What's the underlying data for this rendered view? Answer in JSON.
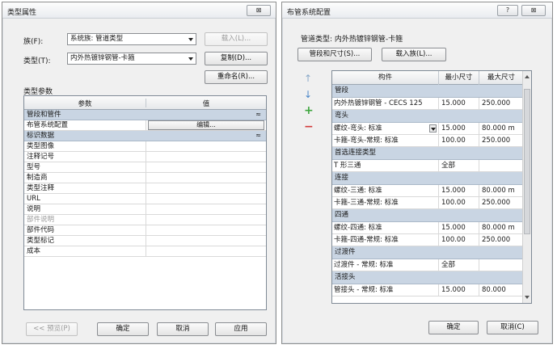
{
  "type_properties": {
    "title": "类型属性",
    "close_label": "⊠",
    "family_label": "族(F):",
    "family_value": "系统族: 管道类型",
    "load_button": "载入(L)...",
    "type_label": "类型(T):",
    "type_value": "内外热镀锌钢管-卡箍",
    "duplicate_button": "复制(D)...",
    "rename_button": "重命名(R)...",
    "section_label": "类型参数",
    "col_param": "参数",
    "col_value": "值",
    "groups": [
      {
        "name": "管段和管件",
        "caret": "≈",
        "rows": [
          {
            "param": "布管系统配置",
            "value": "编辑..."
          }
        ]
      },
      {
        "name": "标识数据",
        "caret": "≈",
        "rows": [
          {
            "param": "类型图像"
          },
          {
            "param": "注释记号"
          },
          {
            "param": "型号"
          },
          {
            "param": "制造商"
          },
          {
            "param": "类型注释"
          },
          {
            "param": "URL"
          },
          {
            "param": "说明"
          },
          {
            "param": "部件说明"
          },
          {
            "param": "部件代码"
          },
          {
            "param": "类型标记"
          },
          {
            "param": "成本"
          }
        ]
      }
    ],
    "preview_button": "<< 预览(P)",
    "ok_button": "确定",
    "cancel_button": "取消",
    "apply_button": "应用"
  },
  "routing_config": {
    "title": "布管系统配置",
    "help_label": "?",
    "close_label": "⊠",
    "pipe_type_label": "管道类型: 内外热镀锌钢管-卡箍",
    "segments_button": "管段和尺寸(S)...",
    "load_family_button": "载入族(L)...",
    "col_component": "构件",
    "col_min": "最小尺寸",
    "col_max": "最大尺寸",
    "sections": [
      {
        "name": "管段",
        "rows": [
          {
            "component": "内外热镀锌钢管 - CECS 125",
            "min": "15.000",
            "max": "250.000"
          }
        ]
      },
      {
        "name": "弯头",
        "rows": [
          {
            "component": "螺纹-弯头: 标准",
            "min": "15.000",
            "max": "80.000 m",
            "dropdown": true
          },
          {
            "component": "卡箍-弯头-常规: 标准",
            "min": "100.00",
            "max": "250.000"
          }
        ]
      },
      {
        "name": "首选连接类型",
        "rows": [
          {
            "component": "T 形三通",
            "min": "全部",
            "max": ""
          }
        ]
      },
      {
        "name": "连接",
        "rows": [
          {
            "component": "螺纹-三通: 标准",
            "min": "15.000",
            "max": "80.000 m"
          },
          {
            "component": "卡箍-三通-常规: 标准",
            "min": "100.00",
            "max": "250.000"
          }
        ]
      },
      {
        "name": "四通",
        "rows": [
          {
            "component": "螺纹-四通: 标准",
            "min": "15.000",
            "max": "80.000 m"
          },
          {
            "component": "卡箍-四通-常规: 标准",
            "min": "100.00",
            "max": "250.000"
          }
        ]
      },
      {
        "name": "过渡件",
        "rows": [
          {
            "component": "过渡件 - 常规: 标准",
            "min": "全部",
            "max": ""
          }
        ]
      },
      {
        "name": "活接头",
        "rows": [
          {
            "component": "管接头 - 常规: 标准",
            "min": "15.000",
            "max": "80.000"
          }
        ]
      }
    ],
    "ok_button": "确定",
    "cancel_button": "取消(C)",
    "icons": [
      "move-up-icon",
      "move-down-icon",
      "add-row-icon",
      "remove-row-icon"
    ],
    "colors": {
      "group_row": "#c9d5e3",
      "add": "#3fa63f",
      "remove": "#d23a3a",
      "arrows": "#4a86c8"
    }
  }
}
